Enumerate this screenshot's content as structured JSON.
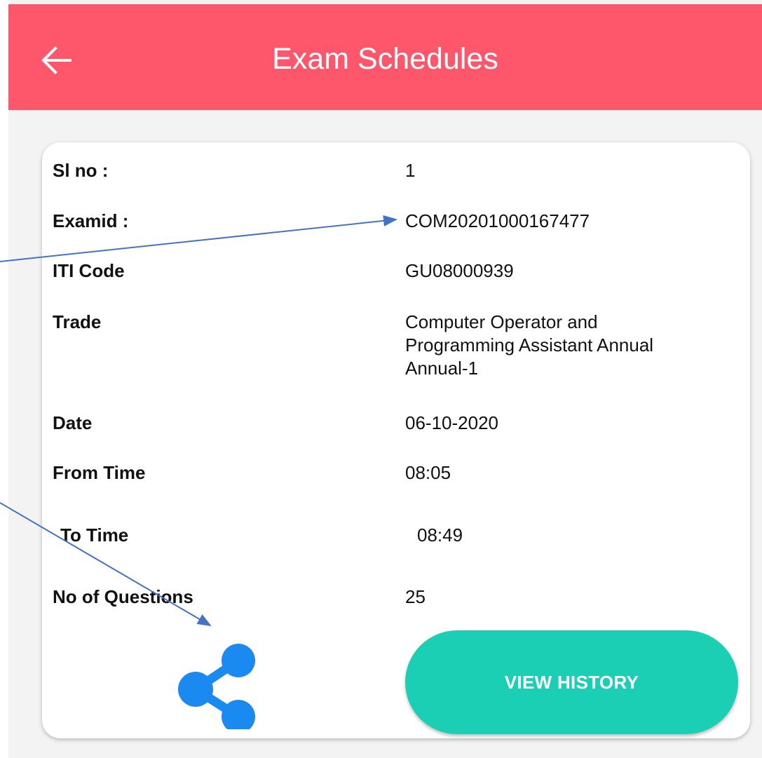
{
  "header": {
    "title": "Exam Schedules",
    "back_icon": "arrow-left-icon"
  },
  "colors": {
    "header": "#fe566b",
    "button": "#1bcfb4",
    "share_icon": "#1a8af0",
    "annotation_arrow": "#4472c4"
  },
  "exam": {
    "fields": [
      {
        "label": "Sl no :",
        "value": "1"
      },
      {
        "label": "Examid :",
        "value": "COM20201000167477"
      },
      {
        "label": "ITI Code",
        "value": "GU08000939"
      },
      {
        "label": "Trade",
        "value": "Computer Operator and Programming Assistant Annual Annual-1"
      },
      {
        "label": "Date",
        "value": "06-10-2020"
      },
      {
        "label": "From Time",
        "value": "08:05"
      },
      {
        "label": "To Time",
        "value": "08:49"
      },
      {
        "label": "No of Questions",
        "value": "25"
      }
    ]
  },
  "actions": {
    "share_icon": "share-icon",
    "view_history_label": "VIEW HISTORY"
  }
}
